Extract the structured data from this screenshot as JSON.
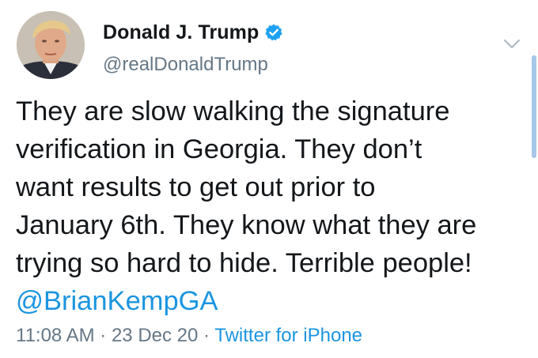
{
  "user": {
    "display_name": "Donald J. Trump",
    "handle": "@realDonaldTrump",
    "verified": true,
    "verified_icon": "verified-badge-icon"
  },
  "tweet": {
    "text": "They are slow walking the signature\nverification in Georgia. They don’t\nwant results to get out prior to\nJanuary 6th. They know what they are\ntrying so hard to hide. Terrible people!",
    "mention": "@BrianKempGA",
    "time": "11:08 AM",
    "separator": " · ",
    "date": "23 Dec 20",
    "source": "Twitter for iPhone"
  },
  "icons": {
    "menu": "chevron-down-icon",
    "avatar": "profile-photo"
  },
  "colors": {
    "link": "#1b95e0",
    "secondary_text": "#657786",
    "primary_text": "#14171a",
    "verified": "#1da1f2"
  }
}
